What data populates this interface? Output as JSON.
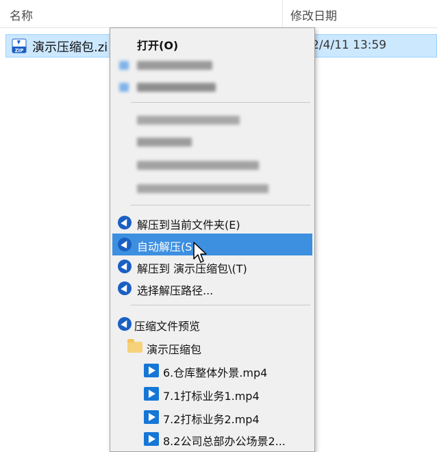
{
  "header": {
    "name_col": "名称",
    "sort_indicator": "^",
    "date_col": "修改日期"
  },
  "file": {
    "name": "演示压缩包.zi",
    "date": "2/4/11 13:59",
    "icon": "zip-icon"
  },
  "menu": {
    "open": "打开(O)",
    "extract_here": "解压到当前文件夹(E)",
    "auto_extract": "自动解压(S)",
    "extract_to": "解压到 演示压缩包\\(T)",
    "choose_path": "选择解压路径...",
    "preview": "压缩文件预览",
    "folder": "演示压缩包",
    "files": [
      "6.仓库整体外景.mp4",
      "7.1打标业务1.mp4",
      "7.2打标业务2.mp4",
      "8.2公司总部办公场景2..."
    ]
  },
  "colors": {
    "highlight": "#3d8fe0",
    "selection": "#cce8ff",
    "badge": "#1a5fc4"
  }
}
